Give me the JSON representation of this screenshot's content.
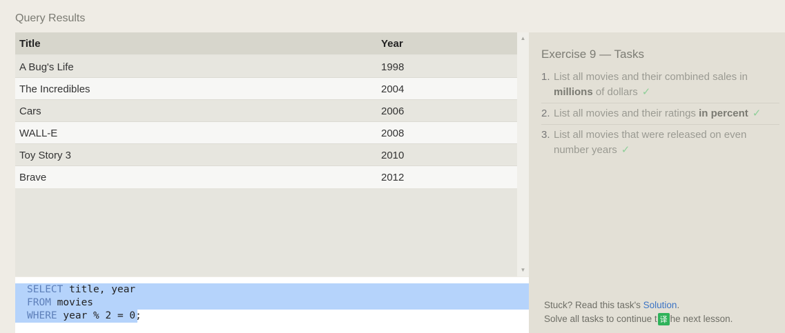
{
  "results_heading": "Query Results",
  "table": {
    "columns": [
      "Title",
      "Year"
    ],
    "rows": [
      [
        "A Bug's Life",
        "1998"
      ],
      [
        "The Incredibles",
        "2004"
      ],
      [
        "Cars",
        "2006"
      ],
      [
        "WALL-E",
        "2008"
      ],
      [
        "Toy Story 3",
        "2010"
      ],
      [
        "Brave",
        "2012"
      ]
    ]
  },
  "scrollbar": {
    "up_icon": "▲",
    "down_icon": "▼"
  },
  "editor": {
    "lines": [
      {
        "keyword": "SELECT",
        "rest": " title, year"
      },
      {
        "keyword": "FROM",
        "rest": " movies"
      },
      {
        "keyword": "WHERE",
        "rest": " year % 2 = 0;"
      }
    ]
  },
  "tasks": {
    "title": "Exercise 9 — Tasks",
    "items": [
      {
        "num": "1.",
        "pre": "List all movies and their combined sales in ",
        "bold": "millions",
        "post": " of dollars",
        "check": "✓"
      },
      {
        "num": "2.",
        "pre": "List all movies and their ratings ",
        "bold": "in percent",
        "post": "",
        "check": "✓"
      },
      {
        "num": "3.",
        "pre": "List all movies that were released on even number years",
        "bold": "",
        "post": "",
        "check": "✓"
      }
    ]
  },
  "help": {
    "stuck_prefix": "Stuck? Read this task's ",
    "solution_link": "Solution",
    "stuck_suffix": ".",
    "continue_pre": "Solve all tasks to continue t",
    "badge": "译",
    "continue_post": "he next lesson."
  },
  "colors": {
    "keyword": "#5d7fb9",
    "selection": "#b5d3fb",
    "check": "#8fcf99",
    "link": "#3b73c4"
  }
}
